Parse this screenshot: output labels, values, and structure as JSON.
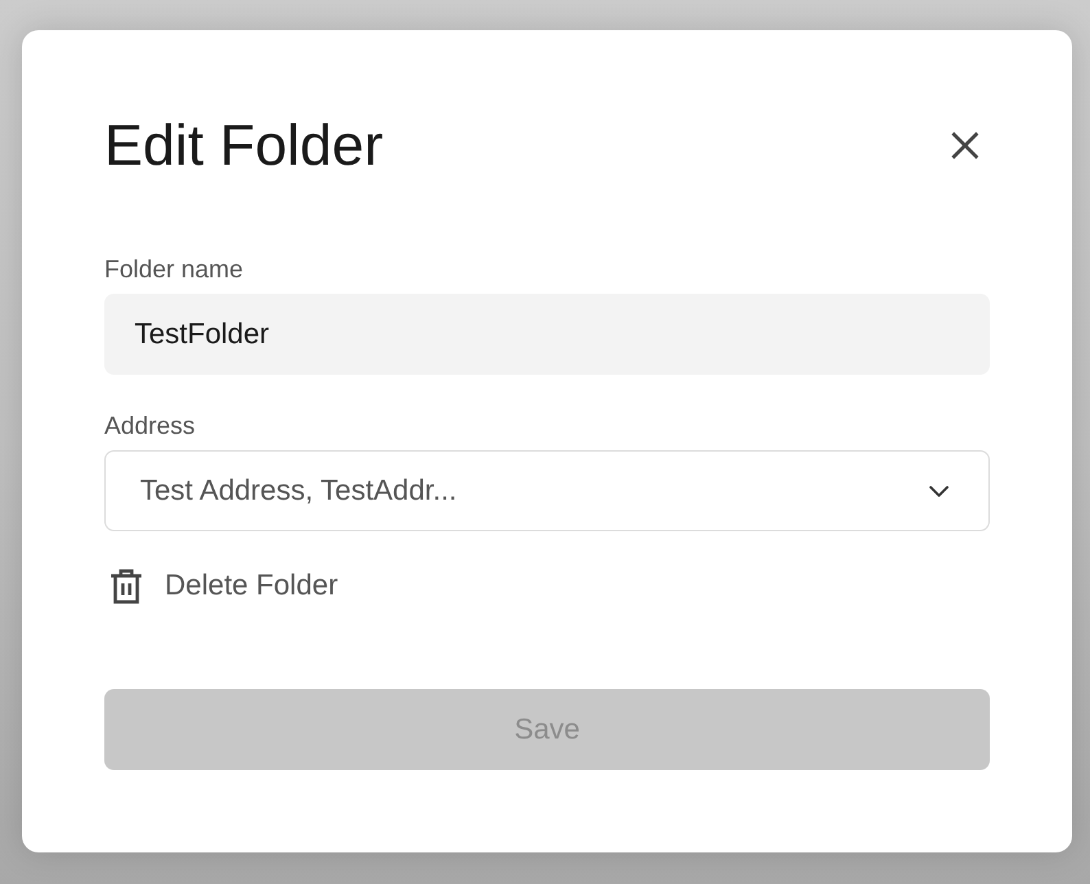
{
  "dialog": {
    "title": "Edit Folder",
    "fields": [
      {
        "kind": "text",
        "label": "Folder name",
        "value": "TestFolder"
      },
      {
        "kind": "select",
        "label": "Address",
        "value": "Test Address, TestAddr..."
      }
    ],
    "delete_action": {
      "label": "Delete Folder"
    },
    "save_button": {
      "label": "Save",
      "disabled": true
    }
  }
}
